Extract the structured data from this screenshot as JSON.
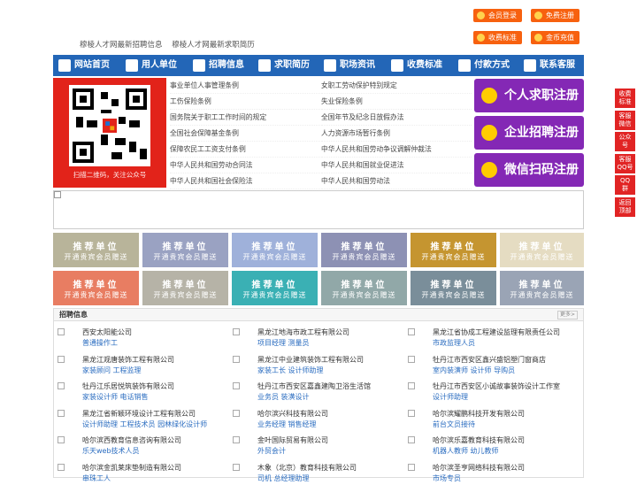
{
  "header": {
    "links": [
      "穆棱人才网最新招聘信息",
      "穆棱人才网最新求职简历"
    ],
    "buttons": [
      "会员登录",
      "免费注册",
      "收费标准",
      "金币充值"
    ]
  },
  "nav": [
    "网站首页",
    "用人单位",
    "招聘信息",
    "求职简历",
    "职场资讯",
    "收费标准",
    "付款方式",
    "联系客服"
  ],
  "qr": {
    "caption": "扫描二维码，关注公众号"
  },
  "links_left": [
    "事业单位人事管理条例",
    "工伤保险条例",
    "国务院关于职工工作时间的规定",
    "全国社会保障基金条例",
    "保障农民工工资支付条例",
    "中华人民共和国劳动合同法",
    "中华人民共和国社会保险法"
  ],
  "links_right": [
    "女职工劳动保护特别规定",
    "失业保险条例",
    "全国年节及纪念日放假办法",
    "人力资源市场暂行条例",
    "中华人民共和国劳动争议调解仲裁法",
    "中华人民共和国就业促进法",
    "中华人民共和国劳动法"
  ],
  "register": [
    "个人求职注册",
    "企业招聘注册",
    "微信扫码注册"
  ],
  "recommend": {
    "title": "推荐单位",
    "subtitle": "开通贵宾会员赠送",
    "colors": [
      "#b8b49a",
      "#9aa2c2",
      "#9fb1da",
      "#8d91b4",
      "#c59530",
      "#e5dcc2",
      "#e87d62",
      "#b6b3a7",
      "#3ab0b4",
      "#91a8a8",
      "#7a8e9a",
      "#9aa4b5"
    ]
  },
  "jobs": {
    "title": "招聘信息",
    "more": "更多>",
    "items": [
      {
        "company": "西安太阳能公司",
        "positions": "普通操作工"
      },
      {
        "company": "黑龙江地海市政工程有限公司",
        "positions": "项目经理 测量员"
      },
      {
        "company": "黑龙江省协成工程建设监理有限责任公司",
        "positions": "市政监理人员"
      },
      {
        "company": "黑龙江观唐装饰工程有限公司",
        "positions": "家装顾问 工程监理"
      },
      {
        "company": "黑龙江中业建筑装饰工程有限公司",
        "positions": "家装工长 设计师助理"
      },
      {
        "company": "牡丹江市西安区鑫兴盛铝塑门窗商店",
        "positions": "室内装潢师 设计师 导购员"
      },
      {
        "company": "牡丹江乐居悦筑装饰有限公司",
        "positions": "家装设计师 电话销售"
      },
      {
        "company": "牡丹江市西安区嘉鑫建陶卫浴生活馆",
        "positions": "业务员 装潢设计"
      },
      {
        "company": "牡丹江市西安区小诚故事装饰设计工作室",
        "positions": "设计师助理"
      },
      {
        "company": "黑龙江省新颖环境设计工程有限公司",
        "positions": "设计师助理 工程技术员 园林绿化设计师"
      },
      {
        "company": "哈尔滨兴科技有限公司",
        "positions": "业务经理 销售经理"
      },
      {
        "company": "哈尔滨耀鹏科技开发有限公司",
        "positions": "前台文员接待"
      },
      {
        "company": "哈尔滨西教育信息咨询有限公司",
        "positions": "乐天web技术人员"
      },
      {
        "company": "金叶国际贸易有限公司",
        "positions": "外贸会计"
      },
      {
        "company": "哈尔滨乐嘉教育科技有限公司",
        "positions": "机器人教师 幼儿教师"
      },
      {
        "company": "哈尔滨金凯莱床垫制造有限公司",
        "positions": "串珠工人"
      },
      {
        "company": "木象（北京）教育科技有限公司",
        "positions": "司机 总经理助理"
      },
      {
        "company": "哈尔滨圣亨网络科技有限公司",
        "positions": "市场专员"
      }
    ]
  },
  "side": [
    "收费\n标准",
    "客服\n微信",
    "公众\n号",
    "客服\nQQ号",
    "QQ\n群",
    "返回\n顶部"
  ]
}
